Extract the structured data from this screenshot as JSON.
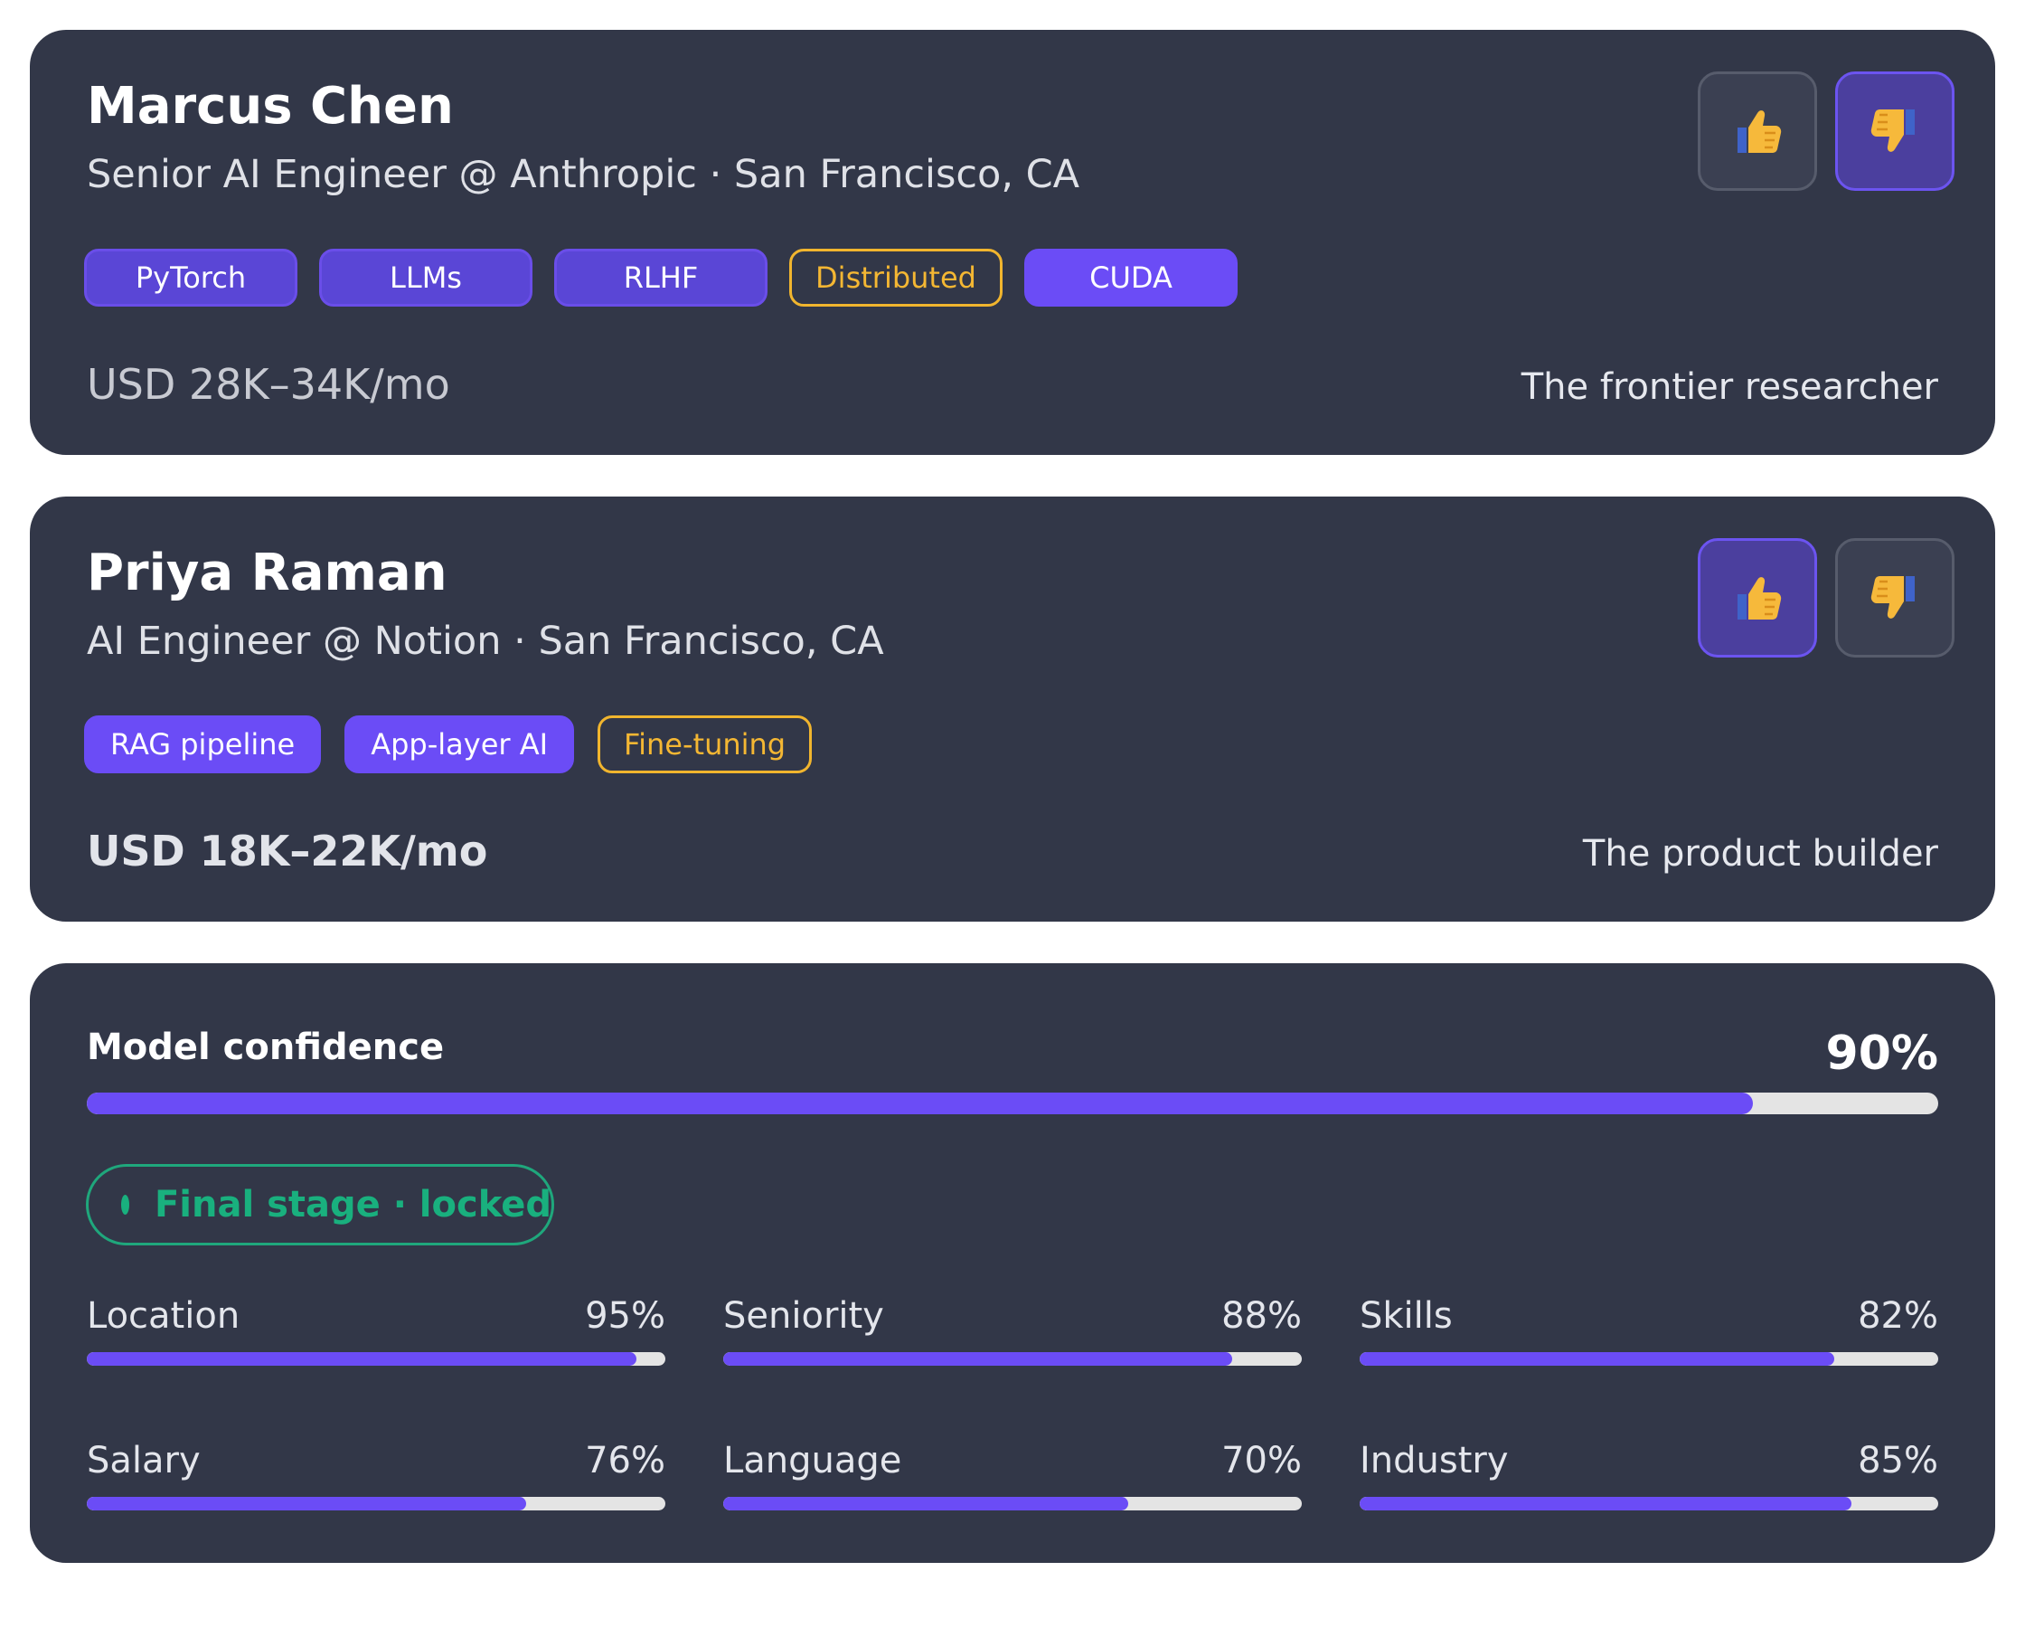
{
  "candidates": [
    {
      "name": "Marcus Chen",
      "subtitle": "Senior AI Engineer @ Anthropic · San Francisco, CA",
      "tags": [
        {
          "label": "PyTorch",
          "style": "soft"
        },
        {
          "label": "LLMs",
          "style": "soft"
        },
        {
          "label": "RLHF",
          "style": "soft"
        },
        {
          "label": "Distributed",
          "style": "outline"
        },
        {
          "label": "CUDA",
          "style": "solid"
        }
      ],
      "salary": "USD 28K–34K/mo",
      "persona": "The frontier researcher",
      "vote": "down",
      "thumbs_up_icon": "thumbs-up-icon",
      "thumbs_down_icon": "thumbs-down-icon"
    },
    {
      "name": "Priya Raman",
      "subtitle": "AI Engineer @ Notion · San Francisco, CA",
      "tags": [
        {
          "label": "RAG pipeline",
          "style": "solid"
        },
        {
          "label": "App-layer AI",
          "style": "solid"
        },
        {
          "label": "Fine-tuning",
          "style": "outline"
        }
      ],
      "salary": "USD 18K–22K/mo",
      "persona": "The product builder",
      "vote": "up",
      "thumbs_up_icon": "thumbs-up-icon",
      "thumbs_down_icon": "thumbs-down-icon"
    }
  ],
  "confidence": {
    "title": "Model confidence",
    "value_label": "90%",
    "value": 90,
    "stage_badge": "Final stage · locked",
    "metrics": [
      {
        "label": "Location",
        "value_label": "95%",
        "value": 95
      },
      {
        "label": "Seniority",
        "value_label": "88%",
        "value": 88
      },
      {
        "label": "Skills",
        "value_label": "82%",
        "value": 82
      },
      {
        "label": "Salary",
        "value_label": "76%",
        "value": 76
      },
      {
        "label": "Language",
        "value_label": "70%",
        "value": 70
      },
      {
        "label": "Industry",
        "value_label": "85%",
        "value": 85
      }
    ]
  },
  "colors": {
    "card_bg": "#323748",
    "accent": "#6b4cf6",
    "tag_outline": "#f1b52e",
    "success": "#19b07e",
    "track": "#e4e4e4"
  }
}
